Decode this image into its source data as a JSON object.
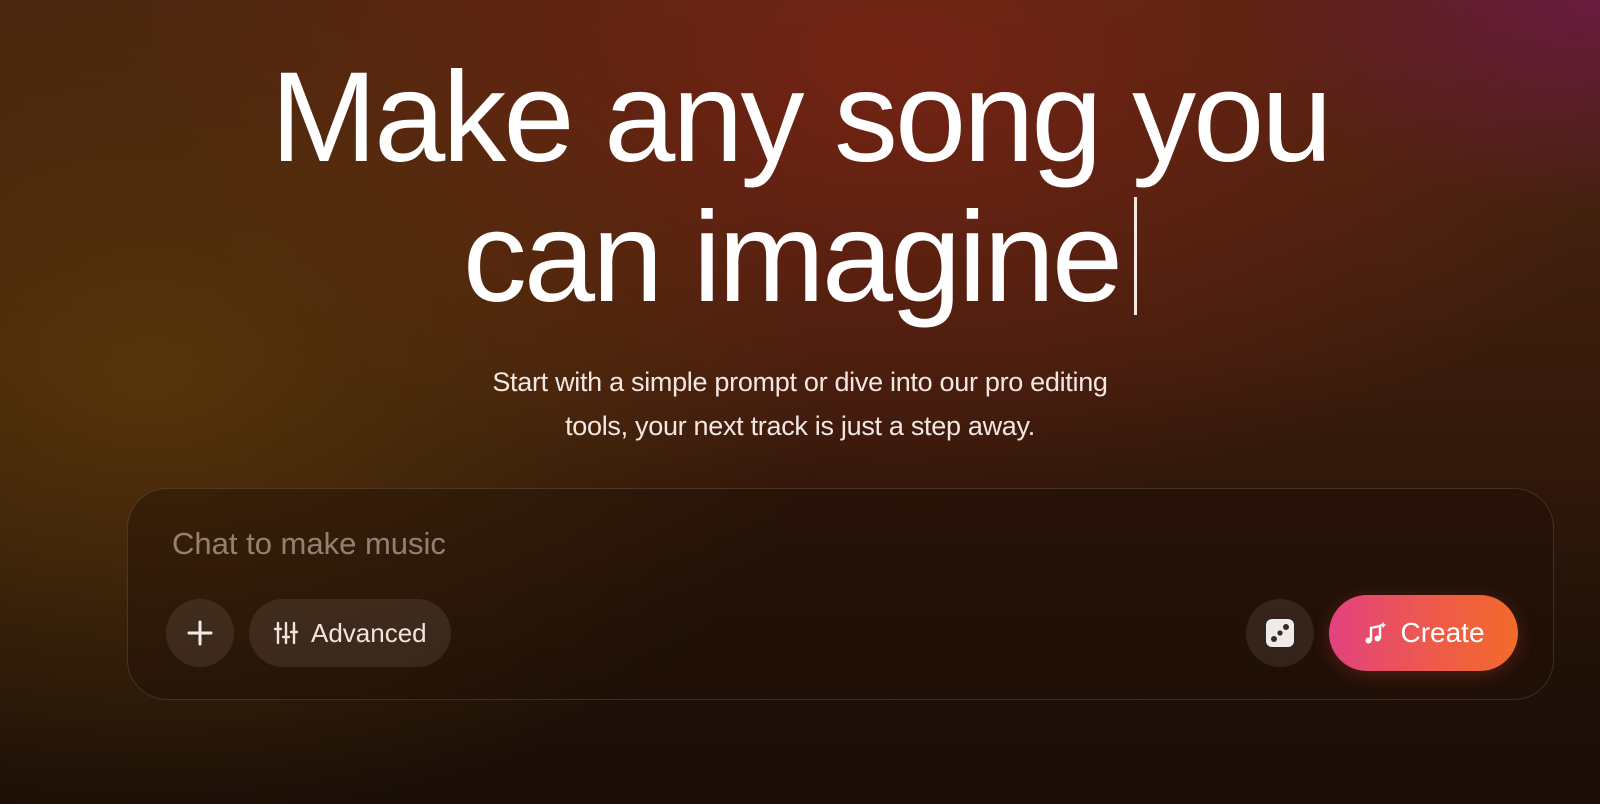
{
  "hero": {
    "headline_line1": "Make any song you",
    "headline_line2": "can imagine",
    "subtitle_line1": "Start with a simple prompt or dive into our pro editing",
    "subtitle_line2": "tools, your next track is just a step away."
  },
  "composer": {
    "placeholder": "Chat to make music",
    "value": "",
    "add_icon": "plus-icon",
    "advanced_label": "Advanced",
    "advanced_icon": "sliders-icon",
    "dice_icon": "dice-icon",
    "create_label": "Create",
    "create_icon": "music-note-sparkle-icon"
  },
  "colors": {
    "create_gradient_start": "#e2427f",
    "create_gradient_end": "#f26a2a",
    "background_top": "#4a2510",
    "background_bottom": "#1a0e07"
  }
}
